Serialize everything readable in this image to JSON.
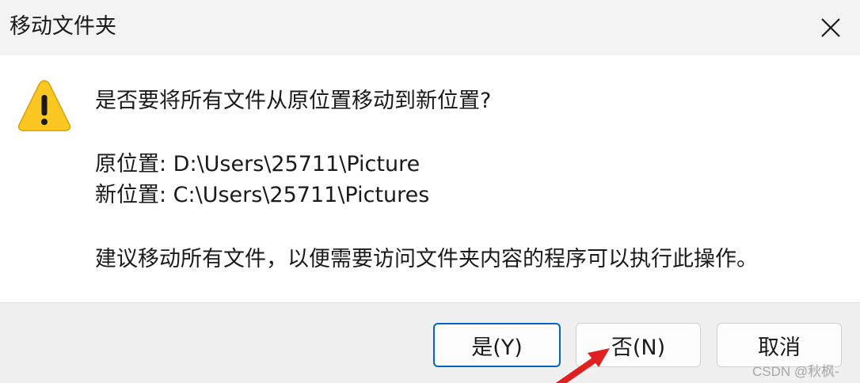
{
  "window": {
    "title": "移动文件夹",
    "close_icon": "close-icon"
  },
  "dialog": {
    "icon": "warning-icon",
    "question": "是否要将所有文件从原位置移动到新位置?",
    "original_location": "原位置: D:\\Users\\25711\\Picture",
    "new_location": "新位置: C:\\Users\\25711\\Pictures",
    "recommendation": "建议移动所有文件，以便需要访问文件夹内容的程序可以执行此操作。"
  },
  "buttons": {
    "yes_label": "是(Y)",
    "no_label": "否(N)",
    "cancel_label": "取消"
  },
  "annotation": {
    "arrow_color": "#e02020"
  },
  "watermark": "CSDN @秋枫-",
  "colors": {
    "titlebar": "#f3f3f3",
    "footer": "#f0f0f0",
    "focus_border": "#0067c0",
    "warning_fill": "#fbc723"
  }
}
